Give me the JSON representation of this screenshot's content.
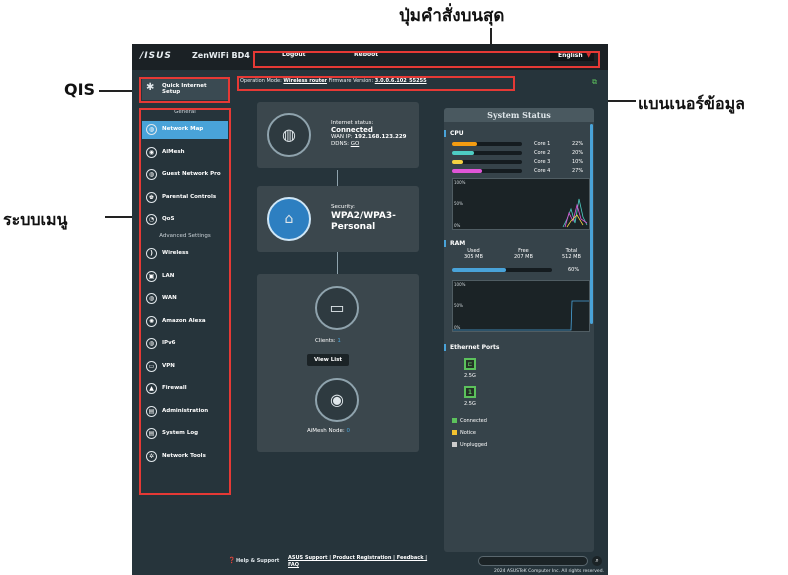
{
  "annotations": {
    "top": "ปุ่มคำสั่งบนสุด",
    "qis": "QIS",
    "banner": "แบนเนอร์ข้อมูล",
    "menu": "ระบบเมนู"
  },
  "colors": {
    "accent": "#49a3d9",
    "annotation_box": "#e53935",
    "cpu_core1": "#f39c12",
    "cpu_core2": "#4ecdc4",
    "cpu_core3": "#f5d142",
    "cpu_core4": "#e056d8",
    "connected": "#5cc25c",
    "notice": "#f2c230",
    "unplugged": "#cccccc"
  },
  "topbar": {
    "logo": "/ISUS",
    "model": "ZenWiFi BD4",
    "logout": "Logout",
    "reboot": "Reboot",
    "language": "English"
  },
  "qis": {
    "label": "Quick Internet Setup"
  },
  "operation_bar": {
    "mode_label": "Operation Mode:",
    "mode_value": "Wireless router",
    "fw_label": "Firmware Version:",
    "fw_value": "3.0.0.6.102_55255"
  },
  "sidebar": {
    "general_title": "General",
    "general": [
      {
        "label": "Network Map",
        "icon": "network-map-icon",
        "glyph": "◍"
      },
      {
        "label": "AiMesh",
        "icon": "aimesh-icon",
        "glyph": "◉"
      },
      {
        "label": "Guest Network Pro",
        "icon": "globe-icon",
        "glyph": "◍"
      },
      {
        "label": "Parental Controls",
        "icon": "parental-icon",
        "glyph": "♚"
      },
      {
        "label": "QoS",
        "icon": "qos-icon",
        "glyph": "◔"
      }
    ],
    "advanced_title": "Advanced Settings",
    "advanced": [
      {
        "label": "Wireless",
        "icon": "wireless-icon",
        "glyph": ")"
      },
      {
        "label": "LAN",
        "icon": "lan-icon",
        "glyph": "▣"
      },
      {
        "label": "WAN",
        "icon": "wan-icon",
        "glyph": "◍"
      },
      {
        "label": "Amazon Alexa",
        "icon": "alexa-icon",
        "glyph": "✺"
      },
      {
        "label": "IPv6",
        "icon": "ipv6-icon",
        "glyph": "◍"
      },
      {
        "label": "VPN",
        "icon": "vpn-icon",
        "glyph": "▭"
      },
      {
        "label": "Firewall",
        "icon": "firewall-icon",
        "glyph": "▲"
      },
      {
        "label": "Administration",
        "icon": "admin-icon",
        "glyph": "▤"
      },
      {
        "label": "System Log",
        "icon": "system-log-icon",
        "glyph": "▤"
      },
      {
        "label": "Network Tools",
        "icon": "tools-icon",
        "glyph": "✲"
      }
    ]
  },
  "network_map": {
    "internet": {
      "status_label": "Internet status:",
      "status_value": "Connected",
      "wan_ip_label": "WAN IP:",
      "wan_ip": "192.168.123.229",
      "ddns_label": "DDNS:",
      "ddns_value": "GO"
    },
    "security": {
      "label": "Security:",
      "value": "WPA2/WPA3-Personal"
    },
    "clients": {
      "label": "Clients:",
      "count": "1",
      "view_list": "View List"
    },
    "aimesh": {
      "label": "AiMesh Node:",
      "count": "0"
    }
  },
  "system_status": {
    "title": "System Status",
    "cpu_title": "CPU",
    "cores": [
      {
        "label": "Core 1",
        "value": "22%",
        "pct": 0.22
      },
      {
        "label": "Core 2",
        "value": "20%",
        "pct": 0.2
      },
      {
        "label": "Core 3",
        "value": "10%",
        "pct": 0.1
      },
      {
        "label": "Core 4",
        "value": "27%",
        "pct": 0.27
      }
    ],
    "graph_labels": [
      "100%",
      "50%",
      "0%"
    ],
    "ram_title": "RAM",
    "ram": {
      "used_label": "Used",
      "used": "305 MB",
      "free_label": "Free",
      "free": "207 MB",
      "total_label": "Total",
      "total": "512 MB",
      "percent": "60%",
      "pct": 0.6
    },
    "eth_title": "Ethernet Ports",
    "ports": [
      {
        "label": "2.5G",
        "state": "connected"
      },
      {
        "label": "2.5G",
        "state": "connected"
      }
    ],
    "legend": {
      "connected": "Connected",
      "notice": "Notice",
      "unplugged": "Unplugged"
    }
  },
  "footer": {
    "help": "Help & Support",
    "links": "ASUS Support | Product Registration | Feedback |",
    "faq": "FAQ",
    "copyright": "2024 ASUSTeK Computer Inc. All rights reserved."
  }
}
